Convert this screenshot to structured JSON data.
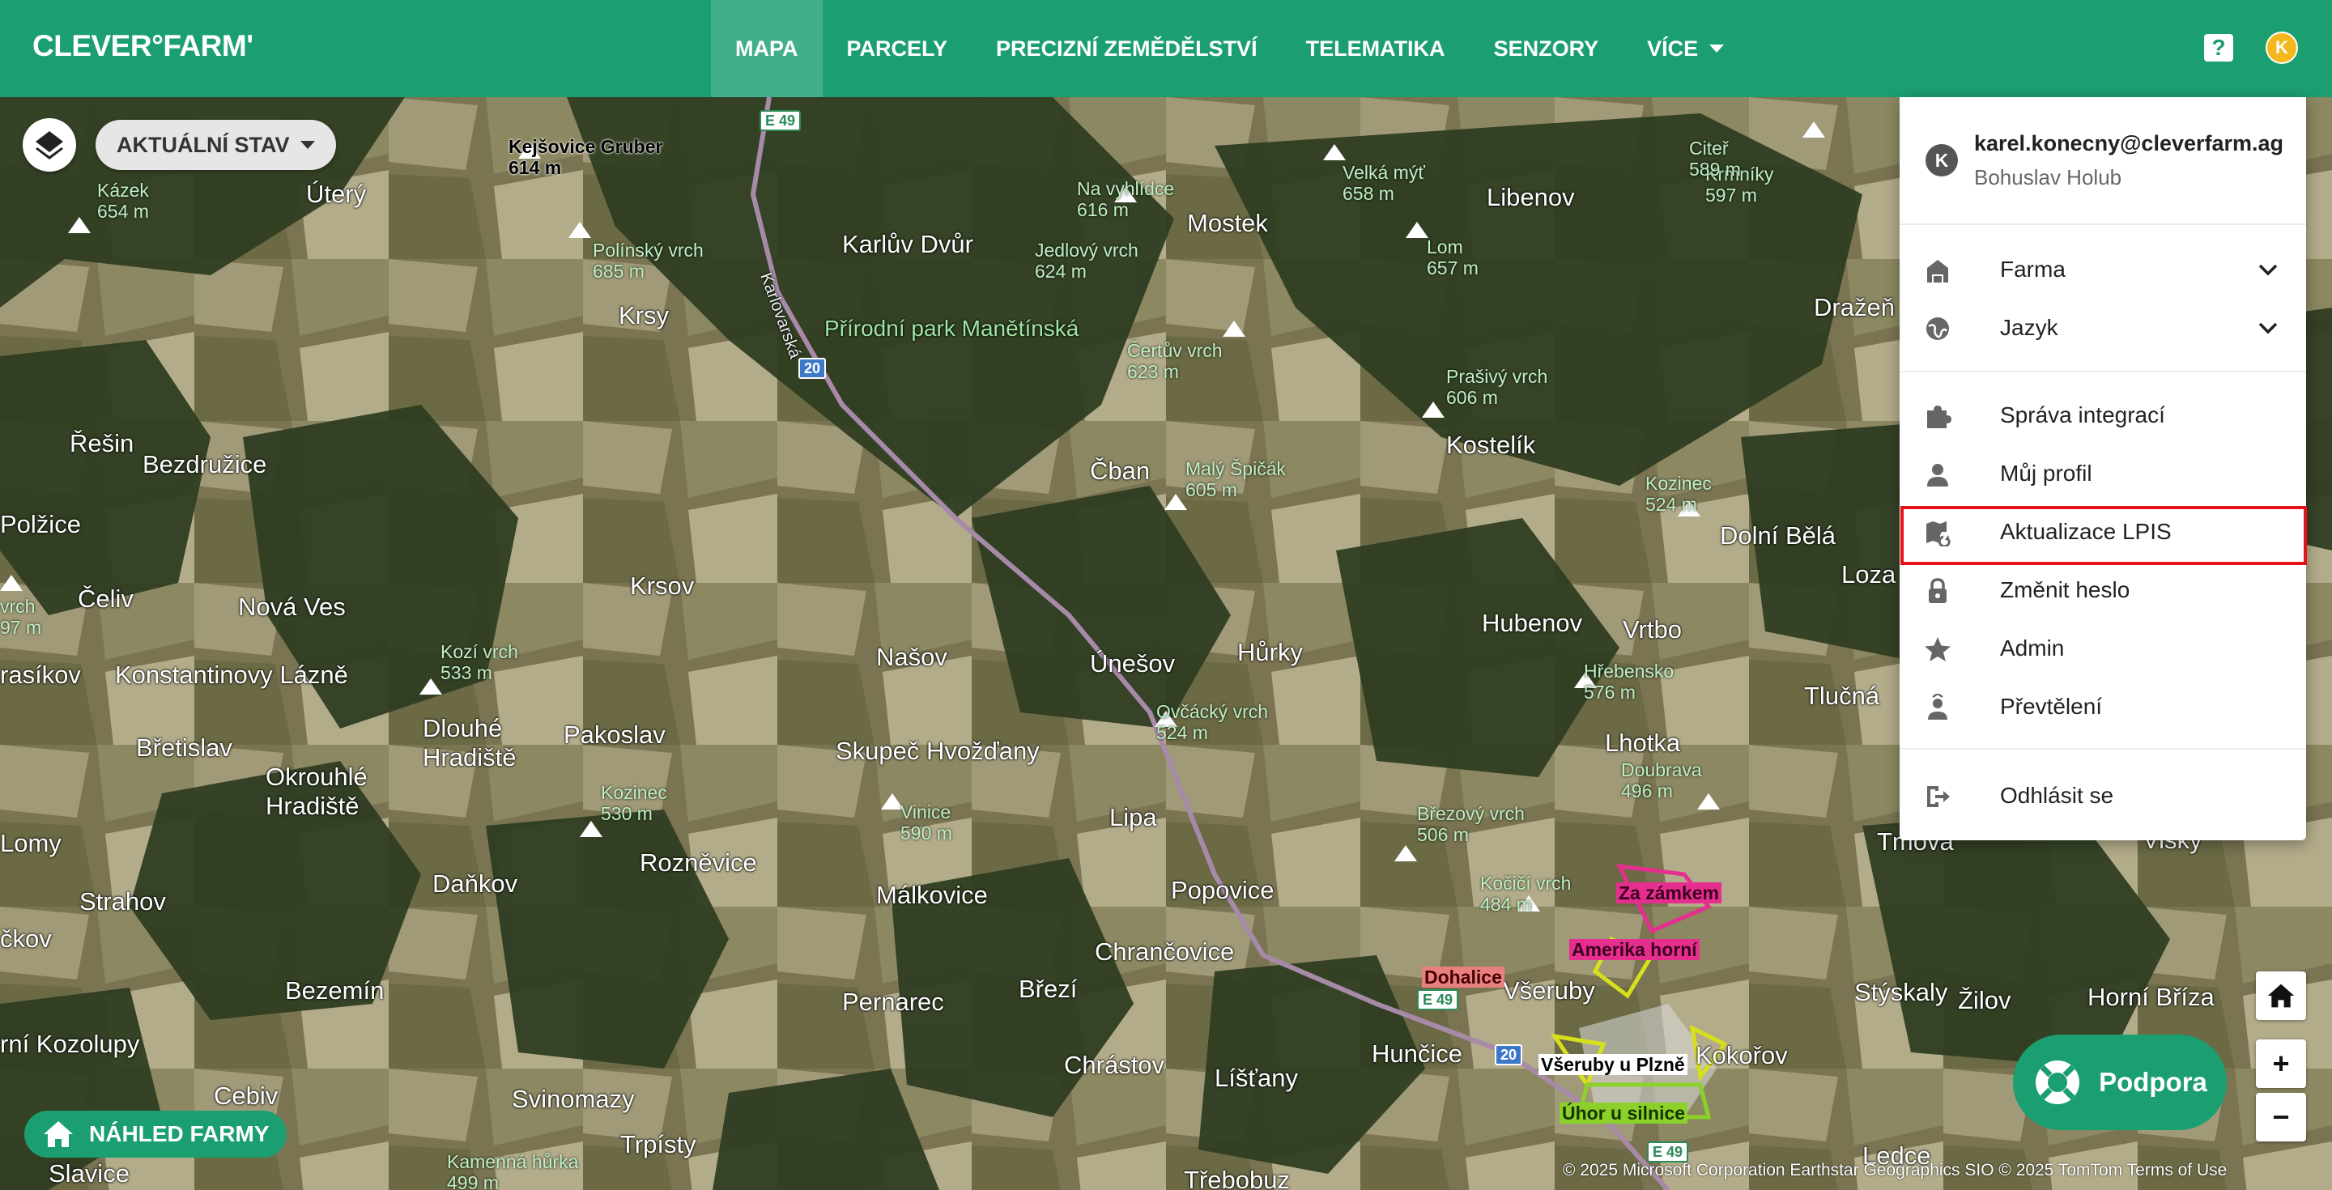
{
  "app": {
    "logo": "CLEVER°FARM'"
  },
  "nav": {
    "items": [
      {
        "label": "MAPA",
        "active": true
      },
      {
        "label": "PARCELY"
      },
      {
        "label": "PRECIZNÍ ZEMĚDĚLSTVÍ"
      },
      {
        "label": "TELEMATIKA"
      },
      {
        "label": "SENZORY"
      },
      {
        "label": "VÍCE"
      }
    ],
    "help_icon": "help-icon",
    "avatar_letter": "K"
  },
  "map": {
    "state_selector": "AKTUÁLNÍ STAV",
    "farm_preview": "NÁHLED FARMY",
    "support": "Podpora",
    "zoom_in": "+",
    "zoom_out": "−",
    "attribution": "© 2025 Microsoft Corporation Earthstar Geographics SIO © 2025 TomTom Terms of Use",
    "places": [
      "Úterý",
      "Karlův Dvůr",
      "Mostek",
      "Libenov",
      "Krsy",
      "Dražeň",
      "Řešin",
      "Bezdružice",
      "Čban",
      "Kostelík",
      "Dolní Bělá",
      "Polžice",
      "Krsov",
      "Loza",
      "Čeliv",
      "Nová Ves",
      "Hubenov",
      "Vrtbo",
      "Našov",
      "Únešov",
      "Hůrky",
      "rasíkov",
      "Konstantinovy Lázně",
      "Tlučná",
      "Dlouhé Hradiště",
      "Pakoslav",
      "Břetislav",
      "Skupeč Hvožďany",
      "Lhotka",
      "Okrouhlé Hradiště",
      "Lipa",
      "Lomy",
      "Rozněvice",
      "Daňkov",
      "Málkovice",
      "Popovice",
      "Strahov",
      "Chrančovice",
      "čkov",
      "Bezemín",
      "Pernarec",
      "Březí",
      "Všeruby",
      "Stýskaly",
      "Žilov",
      "Horní Bříza",
      "rní Kozolupy",
      "Hunčice",
      "Kokořov",
      "Chrástov",
      "Líšťany",
      "Cebiv",
      "Svinomazy",
      "Trpísty",
      "Ledce",
      "Slavice",
      "Třebobuz",
      "Přírodní park Manětínská",
      "Tmova",
      "Visky"
    ],
    "peaks": [
      "Kejšovice Gruber\n614 m",
      "Kázek\n654 m",
      "Polínský vrch\n685 m",
      "Na vyhlídce\n616 m",
      "Jedlový vrch\n624 m",
      "Velká mýť\n658 m",
      "Krmníky\n597 m",
      "Citeř\n589 m",
      "Lom\n657 m",
      "Čertův vrch\n623 m",
      "Prašivý vrch\n606 m",
      "Malý Špičák\n605 m",
      "Kozinec\n524 m",
      "vrch\n97 m",
      "Kozí vrch\n533 m",
      "Hřebensko\n576 m",
      "Ovčácký vrch\n524 m",
      "Kozinec\n530 m",
      "Vinice\n590 m",
      "Doubrava\n496 m",
      "Březový vrch\n506 m",
      "Kočičí vrch\n484 m",
      "Kamenná hůrka\n499 m"
    ],
    "roads": [
      "E 49",
      "20",
      "E 49",
      "20",
      "E 49"
    ],
    "road_names": [
      "Karlovarská"
    ],
    "parcels": [
      "Za zámkem",
      "Amerika horní",
      "Dohalice",
      "Všeruby u Plzně",
      "Úhor u silnice"
    ]
  },
  "user_menu": {
    "avatar_letter": "K",
    "email": "karel.konecny@cleverfarm.ag",
    "name": "Bohuslav Holub",
    "items": [
      {
        "label": "Farma",
        "icon": "farm-icon",
        "expandable": true
      },
      {
        "label": "Jazyk",
        "icon": "globe-icon",
        "expandable": true
      },
      {
        "label": "Správa integrací",
        "icon": "puzzle-icon"
      },
      {
        "label": "Můj profil",
        "icon": "person-icon"
      },
      {
        "label": "Aktualizace LPIS",
        "icon": "map-refresh-icon",
        "highlighted": true
      },
      {
        "label": "Změnit heslo",
        "icon": "lock-icon"
      },
      {
        "label": "Admin",
        "icon": "star-icon"
      },
      {
        "label": "Převtělení",
        "icon": "impersonate-icon"
      },
      {
        "label": "Odhlásit se",
        "icon": "logout-icon"
      }
    ]
  },
  "colors": {
    "brand_green": "#1b9f71",
    "highlight_red": "#e5111b",
    "avatar_yellow": "#f5b81c"
  }
}
